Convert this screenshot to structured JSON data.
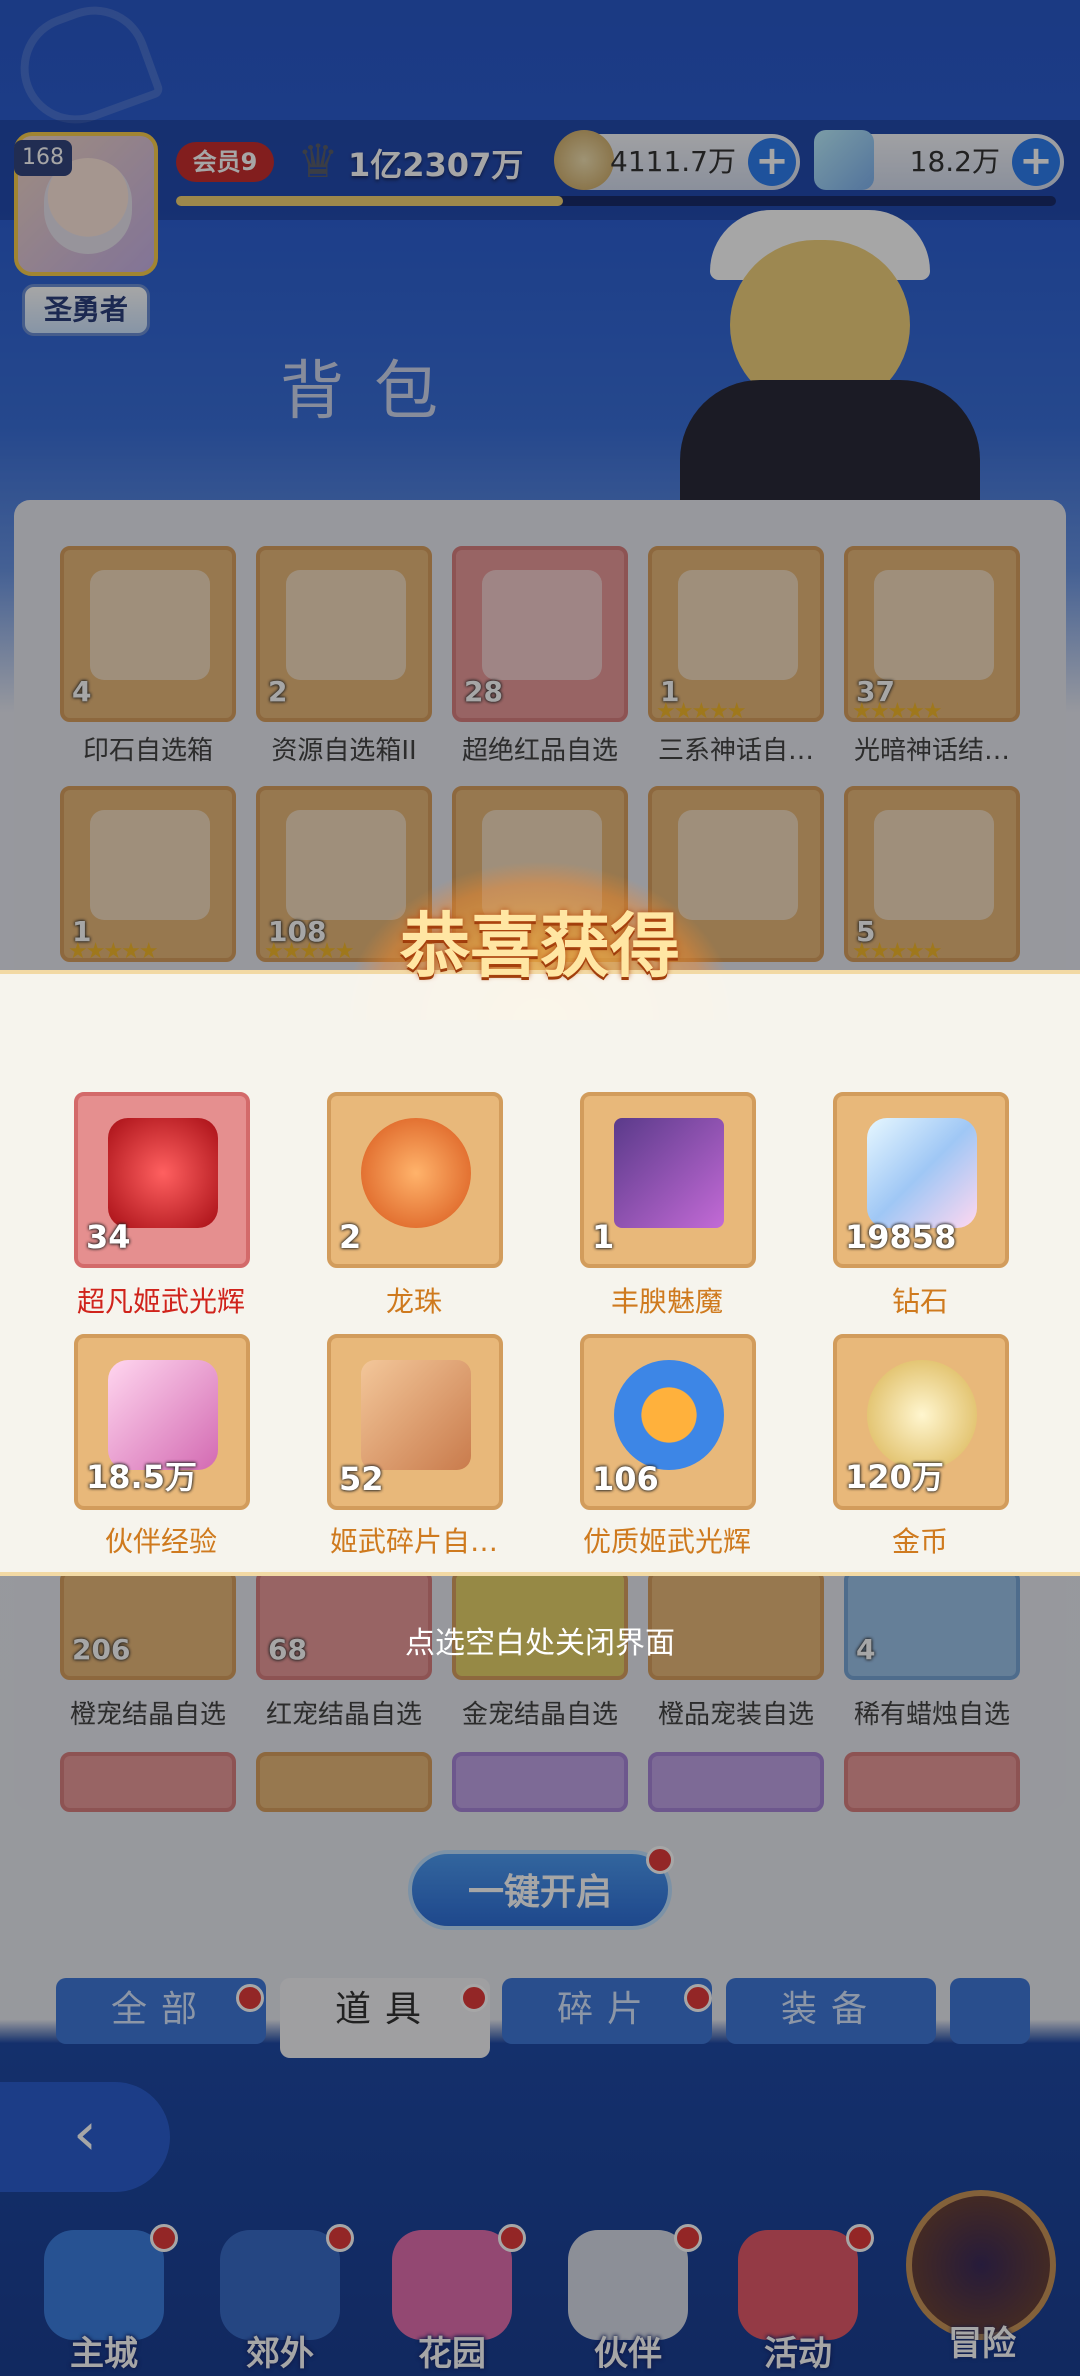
{
  "header": {
    "level": "168",
    "title": "圣勇者",
    "vip": "会员9",
    "power": "1亿2307万",
    "xp_fraction": 0.44,
    "currency1": "4111.7万",
    "currency2": "18.2万",
    "plus": "+"
  },
  "page_title": "背包",
  "grid": {
    "row1": [
      {
        "count": "4",
        "label": "印石自选箱"
      },
      {
        "count": "2",
        "label": "资源自选箱II"
      },
      {
        "count": "28",
        "label": "超绝红品自选"
      },
      {
        "count": "1",
        "label": "三系神话自…"
      },
      {
        "count": "37",
        "label": "光暗神话结…"
      }
    ],
    "row2": [
      {
        "count": "1"
      },
      {
        "count": "108"
      },
      {
        "count": ""
      },
      {
        "count": ""
      },
      {
        "count": "5"
      }
    ],
    "row5": [
      {
        "count": "206",
        "label": "橙宠结晶自选"
      },
      {
        "count": "68",
        "label": "红宠结晶自选"
      },
      {
        "count": "",
        "label": "金宠结晶自选"
      },
      {
        "count": "",
        "label": "橙品宠装自选"
      },
      {
        "count": "4",
        "label": "稀有蜡烛自选"
      }
    ]
  },
  "popup": {
    "title": "恭喜获得",
    "rewards": [
      {
        "count": "34",
        "name": "超凡姬武光辉"
      },
      {
        "count": "2",
        "name": "龙珠"
      },
      {
        "count": "1",
        "name": "丰腴魅魔"
      },
      {
        "count": "19858",
        "name": "钻石"
      },
      {
        "count": "18.5万",
        "name": "伙伴经验"
      },
      {
        "count": "52",
        "name": "姬武碎片自…"
      },
      {
        "count": "106",
        "name": "优质姬武光辉"
      },
      {
        "count": "120万",
        "name": "金币"
      }
    ],
    "close_hint": "点选空白处关闭界面"
  },
  "open_all": "一键开启",
  "tabs": [
    "全部",
    "道具",
    "碎片",
    "装备"
  ],
  "nav": [
    "主城",
    "郊外",
    "花园",
    "伙伴",
    "活动",
    "冒险"
  ],
  "colors": {
    "accent": "#2f7ff0",
    "gold": "#e8b87a",
    "red_item": "#ea9a9a",
    "reward_name": "#cf7a1e"
  }
}
